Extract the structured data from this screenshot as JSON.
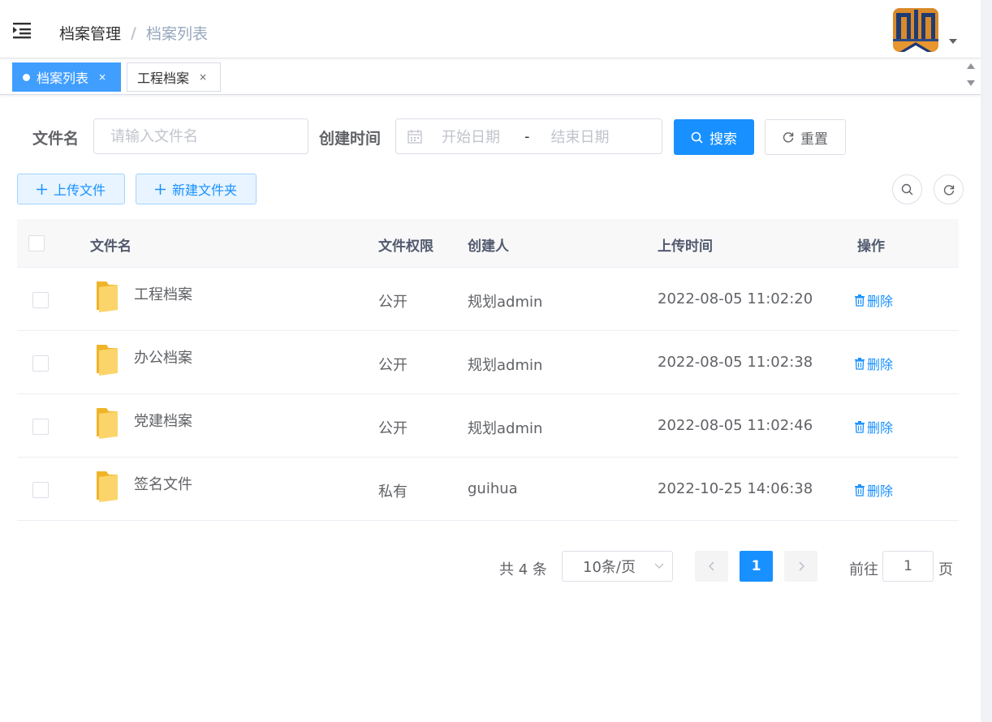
{
  "breadcrumb": {
    "parent": "档案管理",
    "separator": "/",
    "current": "档案列表"
  },
  "tags": [
    {
      "label": "档案列表",
      "close": "×",
      "active": true
    },
    {
      "label": "工程档案",
      "close": "×",
      "active": false
    }
  ],
  "search": {
    "filename_label": "文件名",
    "filename_placeholder": "请输入文件名",
    "created_label": "创建时间",
    "start_placeholder": "开始日期",
    "range_sep": "-",
    "end_placeholder": "结束日期",
    "search_button": "搜索",
    "reset_button": "重置"
  },
  "toolbar": {
    "upload_button": "上传文件",
    "new_folder_button": "新建文件夹"
  },
  "table": {
    "headers": {
      "name": "文件名",
      "permission": "文件权限",
      "creator": "创建人",
      "uploaded": "上传时间",
      "action": "操作"
    },
    "rows": [
      {
        "name": "工程档案",
        "permission": "公开",
        "creator": "规划admin",
        "uploaded": "2022-08-05 11:02:20",
        "action": "删除"
      },
      {
        "name": "办公档案",
        "permission": "公开",
        "creator": "规划admin",
        "uploaded": "2022-08-05 11:02:38",
        "action": "删除"
      },
      {
        "name": "党建档案",
        "permission": "公开",
        "creator": "规划admin",
        "uploaded": "2022-08-05 11:02:46",
        "action": "删除"
      },
      {
        "name": "签名文件",
        "permission": "私有",
        "creator": "guihua",
        "uploaded": "2022-10-25 14:06:38",
        "action": "删除"
      }
    ]
  },
  "pagination": {
    "total_text": "共 4 条",
    "page_size": "10条/页",
    "current_page": "1",
    "goto_prefix": "前往",
    "goto_value": "1",
    "goto_suffix": "页"
  },
  "colors": {
    "primary": "#1890ff",
    "tag_active": "#409eff",
    "folder": "#f7c948"
  },
  "icons": [
    "hamburger-icon",
    "avatar-logo",
    "caret-down-icon",
    "calendar-icon",
    "search-icon",
    "refresh-icon",
    "plus-icon",
    "folder-icon",
    "trash-icon",
    "chevron-left-icon",
    "chevron-right-icon"
  ]
}
